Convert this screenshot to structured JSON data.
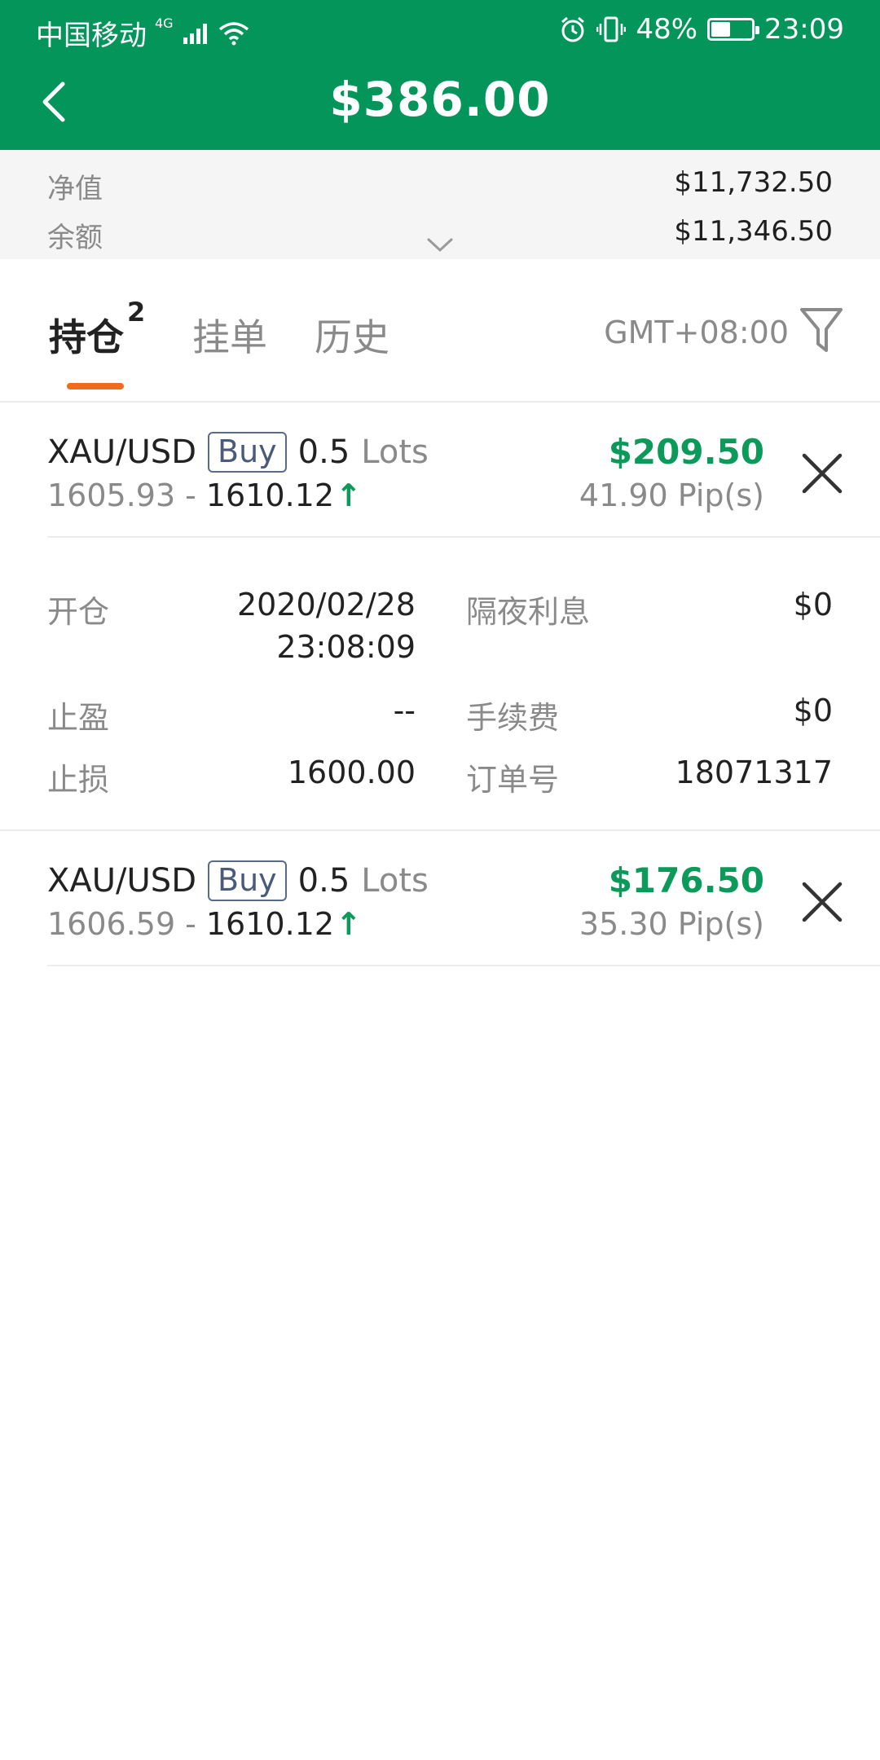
{
  "status_bar": {
    "carrier": "中国移动",
    "network_type": "4G",
    "battery": "48%",
    "battery_level": 0.48,
    "time": "23:09"
  },
  "header": {
    "title": "$386.00"
  },
  "summary": {
    "equity_label": "净值",
    "equity_value": "$11,732.50",
    "balance_label": "余额",
    "balance_value": "$11,346.50"
  },
  "tabs": {
    "items": [
      {
        "label": "持仓",
        "badge": "2"
      },
      {
        "label": "挂单"
      },
      {
        "label": "历史"
      }
    ],
    "active_index": 0,
    "timezone": "GMT+08:00"
  },
  "positions": [
    {
      "symbol": "XAU/USD",
      "side": "Buy",
      "lots": "0.5",
      "lots_unit": "Lots",
      "open_price": "1605.93",
      "separator": "-",
      "current_price": "1610.12",
      "profit": "$209.50",
      "pips": "41.90 Pip(s)",
      "details": {
        "open_label": "开仓",
        "open_date": "2020/02/28",
        "open_time": "23:08:09",
        "tp_label": "止盈",
        "tp_value": "--",
        "sl_label": "止损",
        "sl_value": "1600.00",
        "swap_label": "隔夜利息",
        "swap_value": "$0",
        "fee_label": "手续费",
        "fee_value": "$0",
        "order_label": "订单号",
        "order_value": "18071317"
      }
    },
    {
      "symbol": "XAU/USD",
      "side": "Buy",
      "lots": "0.5",
      "lots_unit": "Lots",
      "open_price": "1606.59",
      "separator": "-",
      "current_price": "1610.12",
      "profit": "$176.50",
      "pips": "35.30 Pip(s)"
    }
  ],
  "colors": {
    "brand_green": "#03955a",
    "profit_green": "#0b9a5a",
    "tab_indicator": "#f26b1d"
  }
}
